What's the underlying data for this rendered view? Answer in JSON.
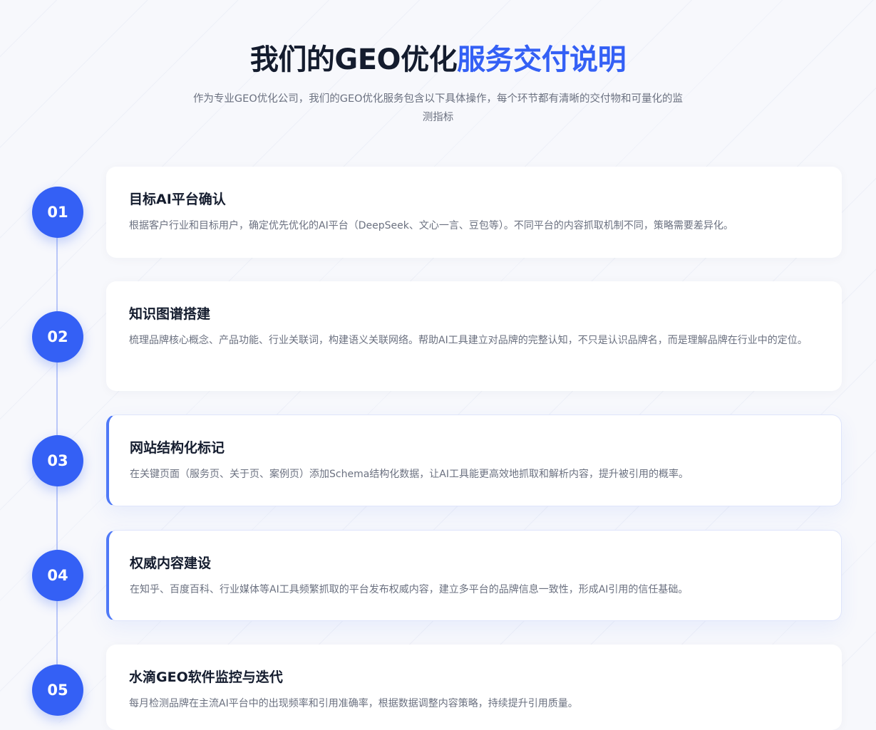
{
  "header": {
    "title_main": "我们的GEO优化",
    "title_accent": "服务交付说明",
    "subtitle": "作为专业GEO优化公司，我们的GEO优化服务包含以下具体操作，每个环节都有清晰的交付物和可量化的监测指标"
  },
  "steps": [
    {
      "number": "01",
      "title": "目标AI平台确认",
      "description": "根据客户行业和目标用户，确定优先优化的AI平台（DeepSeek、文心一言、豆包等）。不同平台的内容抓取机制不同，策略需要差异化。"
    },
    {
      "number": "02",
      "title": "知识图谱搭建",
      "description": "梳理品牌核心概念、产品功能、行业关联词，构建语义关联网络。帮助AI工具建立对品牌的完整认知，不只是认识品牌名，而是理解品牌在行业中的定位。"
    },
    {
      "number": "03",
      "title": "网站结构化标记",
      "description": "在关键页面（服务页、关于页、案例页）添加Schema结构化数据，让AI工具能更高效地抓取和解析内容，提升被引用的概率。"
    },
    {
      "number": "04",
      "title": "权威内容建设",
      "description": "在知乎、百度百科、行业媒体等AI工具频繁抓取的平台发布权威内容，建立多平台的品牌信息一致性，形成AI引用的信任基础。"
    },
    {
      "number": "05",
      "title": "水滴GEO软件监控与迭代",
      "description": "每月检测品牌在主流AI平台中的出现频率和引用准确率，根据数据调整内容策略，持续提升引用质量。"
    }
  ],
  "colors": {
    "accent": "#3460f5",
    "title_text": "#141c2e",
    "body_text": "#6b7180",
    "timeline_line": "#b9c7f8"
  }
}
